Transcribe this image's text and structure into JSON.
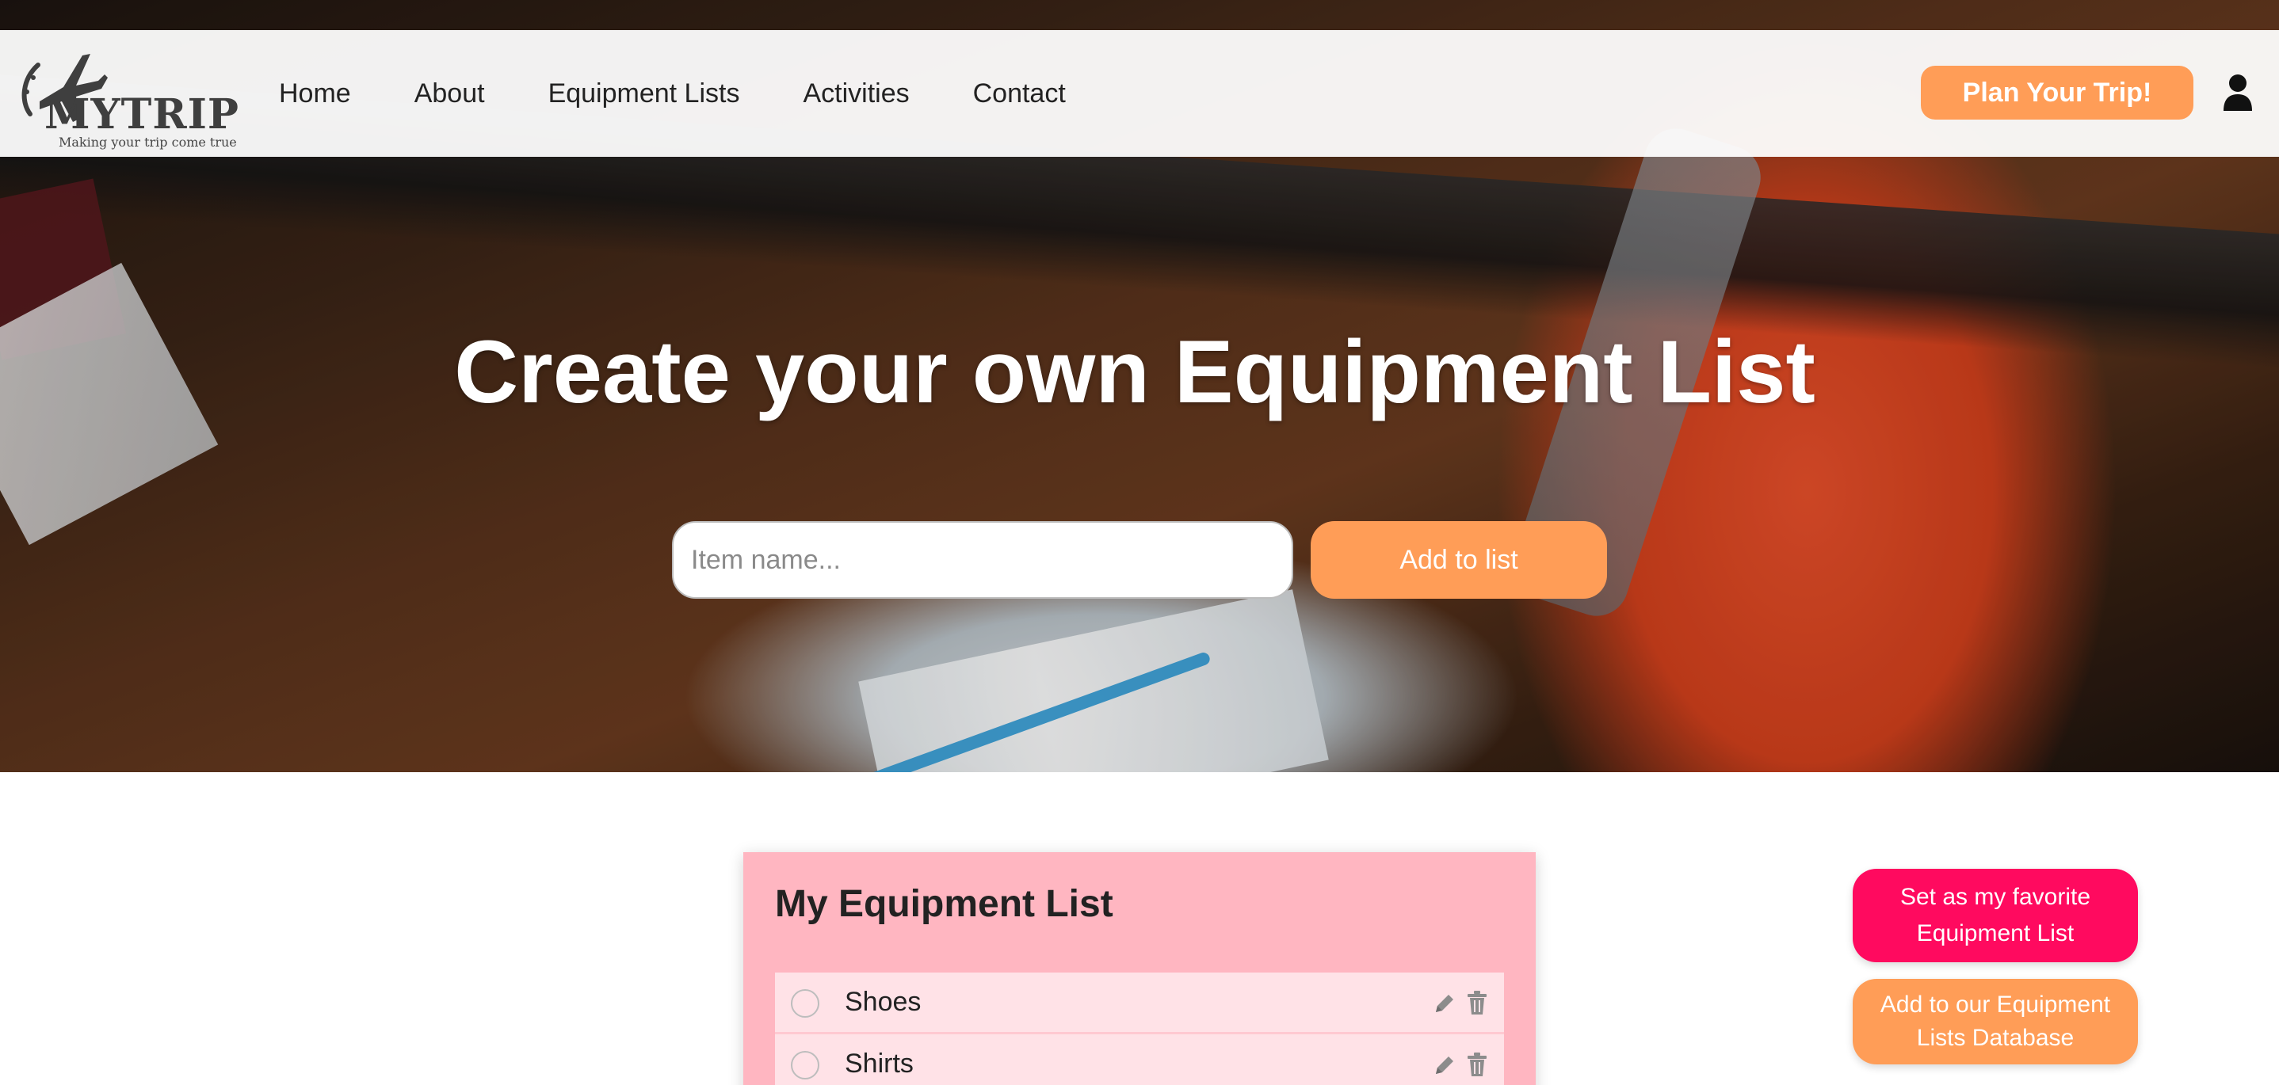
{
  "brand": {
    "name": "MYTRIP",
    "tagline": "Making your trip come true",
    "logo_icon": "airplane-icon"
  },
  "nav": {
    "items": [
      {
        "label": "Home"
      },
      {
        "label": "About"
      },
      {
        "label": "Equipment Lists"
      },
      {
        "label": "Activities"
      },
      {
        "label": "Contact"
      }
    ],
    "cta_label": "Plan Your Trip!",
    "user_icon": "user-icon"
  },
  "hero": {
    "title": "Create your own Equipment List",
    "input_placeholder": "Item name...",
    "add_button_label": "Add to list"
  },
  "list": {
    "title": "My Equipment List",
    "items": [
      {
        "label": "Shoes",
        "checked": false
      },
      {
        "label": "Shirts",
        "checked": false
      }
    ],
    "edit_icon": "pencil-icon",
    "delete_icon": "trash-icon"
  },
  "actions": {
    "favorite_label": "Set as my favorite Equipment List",
    "database_label": "Add to our Equipment Lists Database"
  },
  "colors": {
    "accent_orange": "#ff9d57",
    "accent_pink": "#ff0a5f",
    "card_bg": "#ffb6c1",
    "item_bg": "#ffe2e7"
  }
}
